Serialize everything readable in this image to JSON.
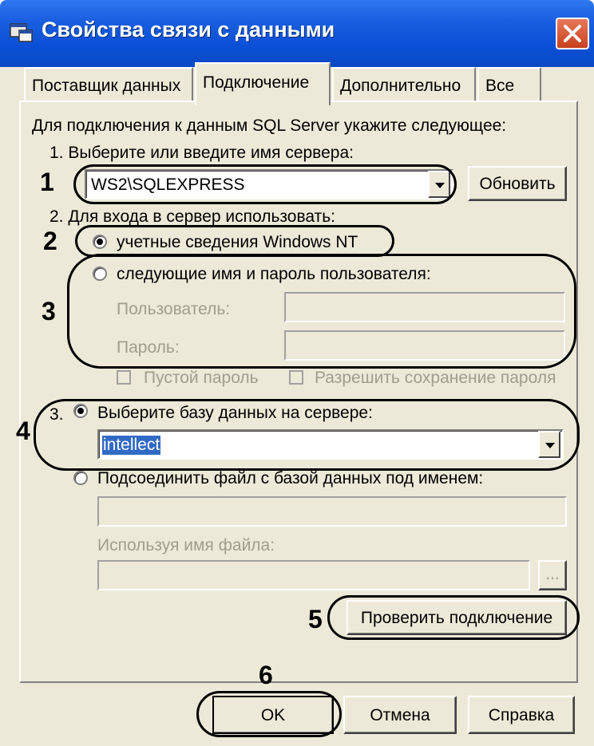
{
  "window": {
    "title": "Свойства связи с данными"
  },
  "tabs": [
    {
      "label": "Поставщик данных"
    },
    {
      "label": "Подключение"
    },
    {
      "label": "Дополнительно"
    },
    {
      "label": "Все"
    }
  ],
  "connection": {
    "intro": "Для подключения к данным SQL Server укажите следующее:",
    "step1_label": "1. Выберите или введите имя сервера:",
    "server_value": "WS2\\SQLEXPRESS",
    "refresh_label": "Обновить",
    "step2_label": "2. Для входа в сервер использовать:",
    "radio_windows": "учетные сведения Windows NT",
    "radio_userpass": "следующие имя и пароль пользователя:",
    "user_label": "Пользователь:",
    "password_label": "Пароль:",
    "blank_password": "Пустой пароль",
    "allow_save": "Разрешить сохранение пароля",
    "step3_prefix": "3.",
    "radio_database": "Выберите базу данных на сервере:",
    "database_value": "intellect",
    "radio_attach": "Подсоединить файл с базой данных под именем:",
    "filename_label": "Используя имя файла:",
    "browse_label": "...",
    "test_label": "Проверить подключение"
  },
  "footer": {
    "ok": "OK",
    "cancel": "Отмена",
    "help": "Справка"
  },
  "annotations": [
    "1",
    "2",
    "3",
    "4",
    "5",
    "6"
  ]
}
